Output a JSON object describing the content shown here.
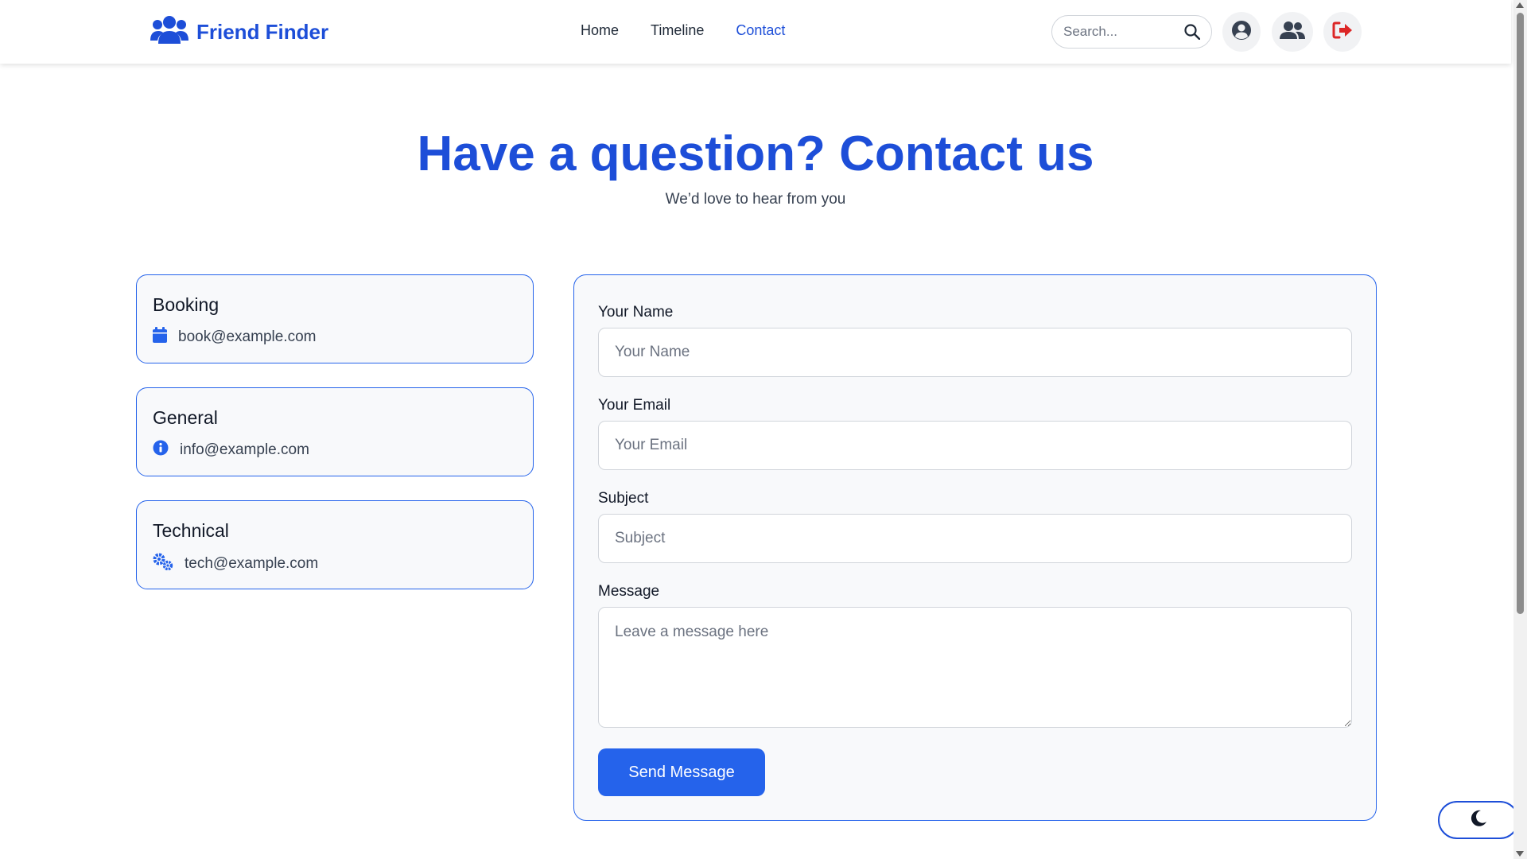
{
  "brand": {
    "name": "Friend Finder",
    "icon": "users-icon"
  },
  "nav": {
    "links": [
      {
        "label": "Home",
        "active": false
      },
      {
        "label": "Timeline",
        "active": false
      },
      {
        "label": "Contact",
        "active": true
      }
    ]
  },
  "search": {
    "placeholder": "Search...",
    "icon": "search-icon"
  },
  "header_actions": [
    {
      "icon": "user-circle-icon"
    },
    {
      "icon": "users-icon"
    },
    {
      "icon": "sign-out-icon"
    }
  ],
  "hero": {
    "title": "Have a question? Contact us",
    "subtitle": "We’d love to hear from you"
  },
  "contacts": [
    {
      "title": "Booking",
      "email": "book@example.com",
      "icon": "calendar-icon"
    },
    {
      "title": "General",
      "email": "info@example.com",
      "icon": "info-circle-icon"
    },
    {
      "title": "Technical",
      "email": "tech@example.com",
      "icon": "gears-icon"
    }
  ],
  "form": {
    "name_label": "Your Name",
    "name_placeholder": "Your Name",
    "email_label": "Your Email",
    "email_placeholder": "Your Email",
    "subject_label": "Subject",
    "subject_placeholder": "Subject",
    "message_label": "Message",
    "message_placeholder": "Leave a message here",
    "submit_label": "Send Message"
  },
  "theme_toggle": {
    "icon": "moon-icon"
  },
  "colors": {
    "primary": "#2563eb",
    "brand": "#1d4ed8",
    "danger": "#dc2626"
  }
}
